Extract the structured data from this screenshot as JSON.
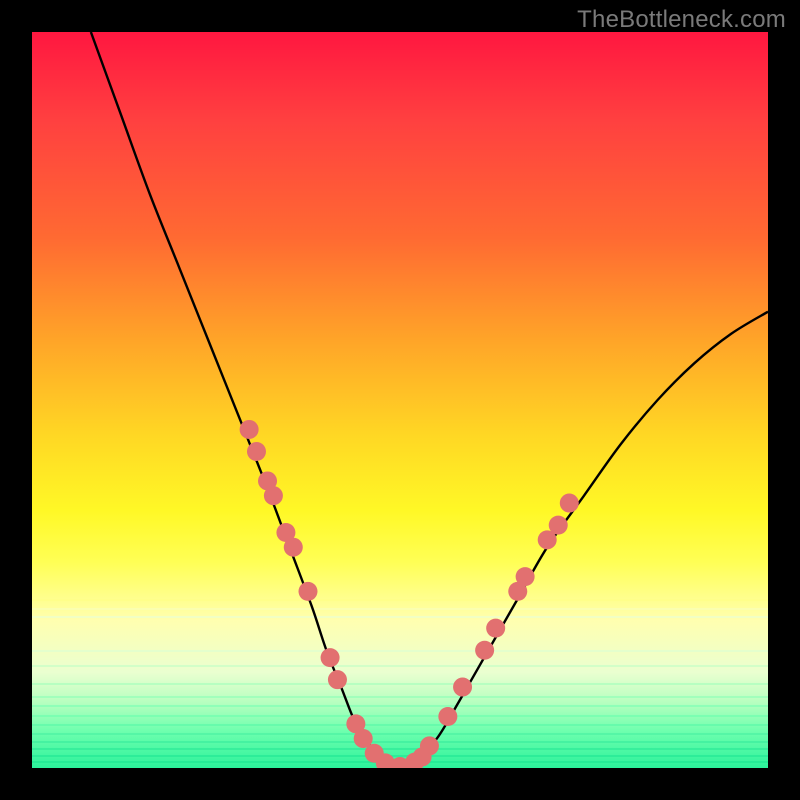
{
  "watermark": "TheBottleneck.com",
  "chart_data": {
    "type": "line",
    "title": "",
    "xlabel": "",
    "ylabel": "",
    "xlim": [
      0,
      100
    ],
    "ylim": [
      0,
      100
    ],
    "series": [
      {
        "name": "curve",
        "x": [
          8,
          12,
          16,
          20,
          24,
          28,
          32,
          35,
          38,
          40,
          42,
          44,
          46,
          48,
          50,
          52,
          55,
          58,
          62,
          66,
          70,
          75,
          80,
          85,
          90,
          95,
          100
        ],
        "y": [
          100,
          89,
          78,
          68,
          58,
          48,
          38,
          30,
          22,
          16,
          11,
          6,
          3,
          1,
          0,
          1,
          4,
          9,
          16,
          23,
          30,
          37,
          44,
          50,
          55,
          59,
          62
        ]
      }
    ],
    "dot_color": "#e27070",
    "dots": [
      {
        "x": 29.5,
        "y": 46
      },
      {
        "x": 30.5,
        "y": 43
      },
      {
        "x": 32.0,
        "y": 39
      },
      {
        "x": 32.8,
        "y": 37
      },
      {
        "x": 34.5,
        "y": 32
      },
      {
        "x": 35.5,
        "y": 30
      },
      {
        "x": 37.5,
        "y": 24
      },
      {
        "x": 40.5,
        "y": 15
      },
      {
        "x": 41.5,
        "y": 12
      },
      {
        "x": 44.0,
        "y": 6
      },
      {
        "x": 45.0,
        "y": 4
      },
      {
        "x": 46.5,
        "y": 2
      },
      {
        "x": 48.0,
        "y": 0.7
      },
      {
        "x": 50.0,
        "y": 0.2
      },
      {
        "x": 52.0,
        "y": 0.8
      },
      {
        "x": 53.0,
        "y": 1.5
      },
      {
        "x": 54.0,
        "y": 3
      },
      {
        "x": 56.5,
        "y": 7
      },
      {
        "x": 58.5,
        "y": 11
      },
      {
        "x": 61.5,
        "y": 16
      },
      {
        "x": 63.0,
        "y": 19
      },
      {
        "x": 66.0,
        "y": 24
      },
      {
        "x": 67.0,
        "y": 26
      },
      {
        "x": 70.0,
        "y": 31
      },
      {
        "x": 71.5,
        "y": 33
      },
      {
        "x": 73.0,
        "y": 36
      }
    ],
    "gradient_bands": [
      {
        "y_pct": 77.0,
        "color": "#ffff8a"
      },
      {
        "y_pct": 78.2,
        "color": "#fbffb0"
      },
      {
        "y_pct": 79.4,
        "color": "#f1ffc4"
      },
      {
        "y_pct": 84.0,
        "color": "#e4ffcd"
      },
      {
        "y_pct": 86.0,
        "color": "#d2ffc8"
      },
      {
        "y_pct": 88.5,
        "color": "#b7ffc1"
      },
      {
        "y_pct": 90.2,
        "color": "#a1ffbc"
      },
      {
        "y_pct": 91.5,
        "color": "#8effb8"
      },
      {
        "y_pct": 92.8,
        "color": "#7bffb2"
      },
      {
        "y_pct": 94.0,
        "color": "#67fbac"
      },
      {
        "y_pct": 95.2,
        "color": "#55f6a6"
      },
      {
        "y_pct": 96.3,
        "color": "#45f2a1"
      },
      {
        "y_pct": 97.3,
        "color": "#37ef9c"
      },
      {
        "y_pct": 98.2,
        "color": "#2ded99"
      },
      {
        "y_pct": 99.1,
        "color": "#25ec96"
      }
    ]
  }
}
